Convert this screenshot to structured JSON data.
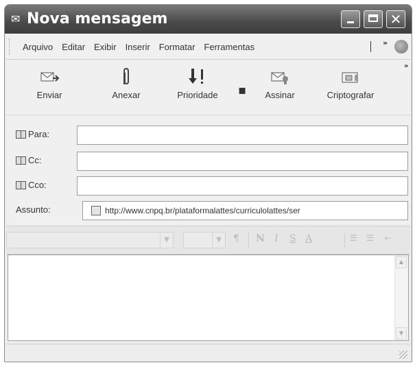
{
  "window": {
    "title": "Nova mensagem"
  },
  "menubar": {
    "items": [
      "Arquivo",
      "Editar",
      "Exibir",
      "Inserir",
      "Formatar",
      "Ferramentas"
    ],
    "overflow": "»"
  },
  "toolbar": {
    "buttons": [
      {
        "label": "Enviar",
        "icon": "send-icon"
      },
      {
        "label": "Anexar",
        "icon": "paperclip-icon"
      },
      {
        "label": "Prioridade",
        "icon": "priority-icon"
      },
      {
        "label": "Assinar",
        "icon": "sign-icon"
      },
      {
        "label": "Criptografar",
        "icon": "encrypt-icon"
      }
    ],
    "overflow": "»"
  },
  "fields": {
    "to": {
      "label": "Para:",
      "value": ""
    },
    "cc": {
      "label": "Cc:",
      "value": ""
    },
    "bcc": {
      "label": "Cco:",
      "value": ""
    },
    "subject": {
      "label": "Assunto:",
      "value": "http://www.cnpq.br/plataformalattes/curriculolattes/ser"
    }
  },
  "format": {
    "bold": "N",
    "italic": "I",
    "underline": "S",
    "color": "A"
  }
}
